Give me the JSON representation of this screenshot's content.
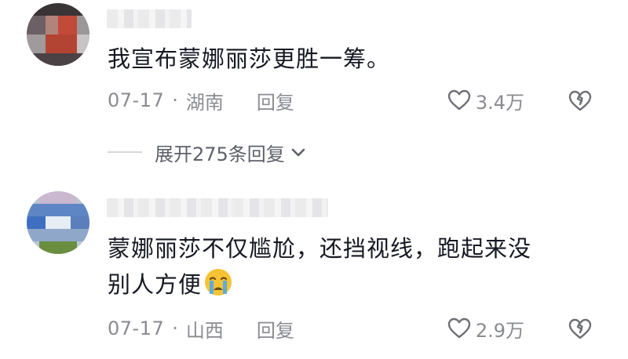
{
  "comments": [
    {
      "text": "我宣布蒙娜丽莎更胜一筹。",
      "date": "07-17",
      "separator": "·",
      "location": "湖南",
      "reply_label": "回复",
      "likes": "3.4万",
      "expand_label": "展开275条回复",
      "icons": {
        "like": "heart-outline-icon",
        "dislike": "broken-heart-icon",
        "expand": "chevron-down-icon"
      }
    },
    {
      "text_line1": "蒙娜丽莎不仅尴尬，还挡视线，跑起来没",
      "text_line2": "别人方便",
      "emoji": "crying-face-emoji",
      "date": "07-17",
      "separator": "·",
      "location": "山西",
      "reply_label": "回复",
      "likes": "2.9万",
      "icons": {
        "like": "heart-outline-icon",
        "dislike": "broken-heart-icon"
      }
    }
  ],
  "colors": {
    "text": "#161823",
    "meta": "#8a8b91",
    "expand": "#5e606a",
    "divider": "#d6d7db",
    "emoji_face": "#f7c233",
    "emoji_tear": "#4aa8f0"
  }
}
